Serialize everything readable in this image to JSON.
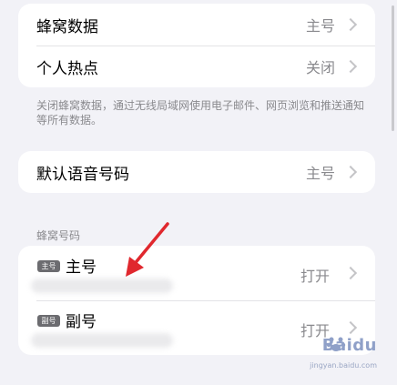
{
  "cellular_card": {
    "rows": [
      {
        "label": "蜂窝数据",
        "value": "主号"
      },
      {
        "label": "个人热点",
        "value": "关闭"
      }
    ]
  },
  "footnote": "关闭蜂窝数据，通过无线局域网使用电子邮件、网页浏览和推送通知等所有数据。",
  "voice_card": {
    "label": "默认语音号码",
    "value": "主号"
  },
  "numbers_section": {
    "header": "蜂窝号码",
    "sims": [
      {
        "badge": "主号",
        "name": "主号",
        "value": "打开"
      },
      {
        "badge": "副号",
        "name": "副号",
        "value": "打开"
      }
    ]
  },
  "colors": {
    "background": "#f2f2f7",
    "card": "#ffffff",
    "secondary_text": "#8a8a8e",
    "annotation_arrow": "#e0282e"
  },
  "icons": [
    "chevron-right-icon",
    "red-arrow-annotation-icon",
    "baidu-paw-icon"
  ],
  "watermark": {
    "brand": "Baidu",
    "sub": "jingyan.baidu.com"
  }
}
